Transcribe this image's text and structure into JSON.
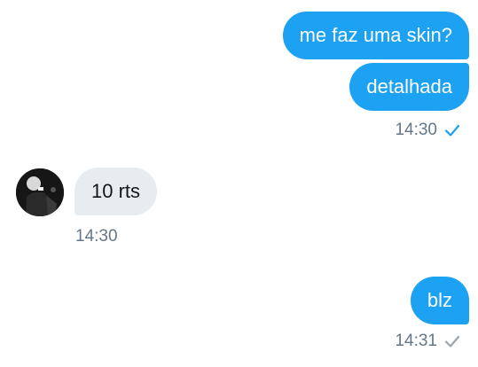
{
  "messages": [
    {
      "text": "me faz uma skin?",
      "direction": "sent"
    },
    {
      "text": "detalhada",
      "direction": "sent"
    },
    {
      "text": "10 rts",
      "direction": "received"
    },
    {
      "text": "blz",
      "direction": "sent"
    }
  ],
  "timestamps": {
    "first_group": "14:30",
    "received": "14:30",
    "last": "14:31"
  },
  "receipts": {
    "first_group": {
      "icon": "checkmark-icon",
      "color": "#1da1f2"
    },
    "last": {
      "icon": "checkmark-icon",
      "color": "#9aa5ad"
    }
  },
  "avatar": {
    "icon": "avatar-photo"
  },
  "colors": {
    "sent_bubble": "#1da1f2",
    "received_bubble": "#e6ecf0",
    "timestamp_text": "#657786"
  }
}
